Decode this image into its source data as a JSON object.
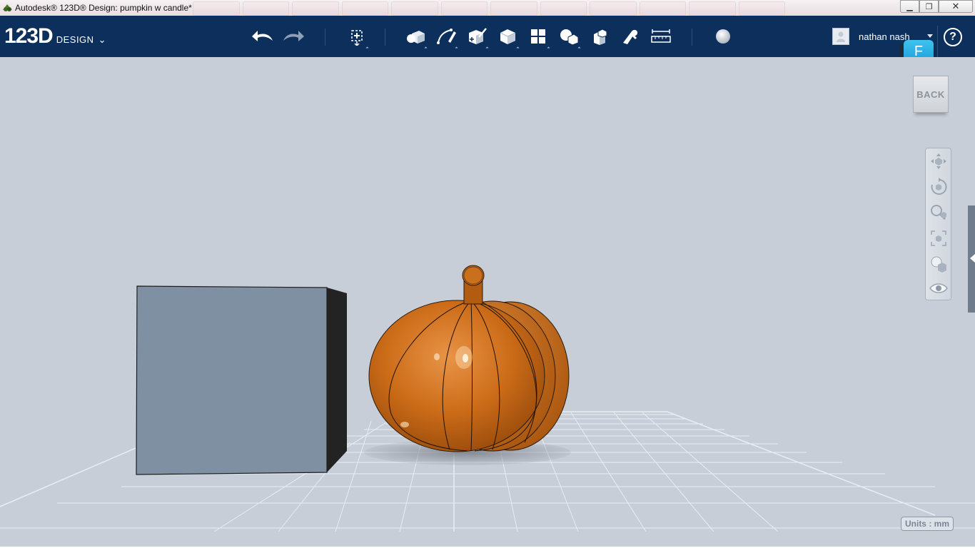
{
  "window": {
    "title": "Autodesk® 123D® Design: pumpkin w candle*",
    "controls": {
      "minimize": "▁",
      "maximize": "❐",
      "close": "✕"
    }
  },
  "app": {
    "logo_main": "123D",
    "logo_sub": "DESIGN",
    "logo_chevron": "⌄"
  },
  "toolbar": {
    "tools": [
      {
        "icon": "undo-icon"
      },
      {
        "icon": "redo-icon"
      },
      {
        "icon": "transform-icon"
      },
      {
        "icon": "primitives-icon"
      },
      {
        "icon": "sketch-icon"
      },
      {
        "icon": "construct-icon"
      },
      {
        "icon": "modify-icon"
      },
      {
        "icon": "pattern-icon"
      },
      {
        "icon": "grouping-icon"
      },
      {
        "icon": "combine-icon"
      },
      {
        "icon": "snap-icon"
      },
      {
        "icon": "measure-icon"
      },
      {
        "icon": "material-icon"
      }
    ]
  },
  "user": {
    "name": "nathan nash",
    "help": "?",
    "badge": "F"
  },
  "viewport": {
    "viewcube_label": "BACK",
    "units": "Units : mm",
    "nav_tools": [
      "pan-icon",
      "orbit-icon",
      "zoom-icon",
      "fit-icon",
      "visual-style-icon",
      "visibility-icon"
    ]
  },
  "colors": {
    "toolbar_bg": "#0d2f5c",
    "viewport_bg": "#c7ced8",
    "pumpkin": "#c96a17",
    "cube_front": "#8090a3",
    "cube_side": "#232323"
  }
}
